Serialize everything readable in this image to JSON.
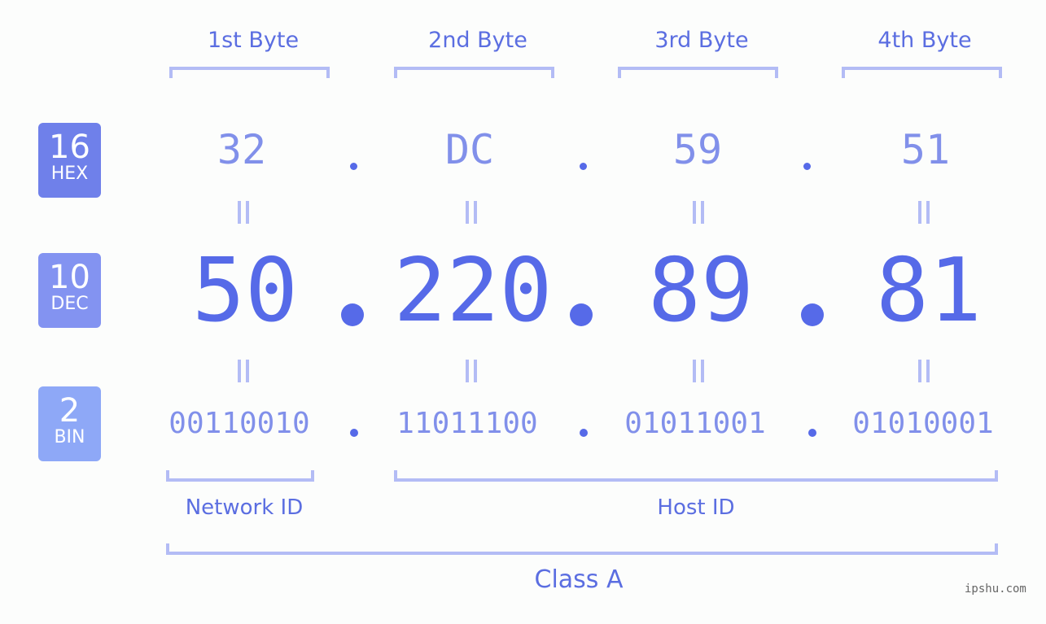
{
  "headers": [
    "1st Byte",
    "2nd Byte",
    "3rd Byte",
    "4th Byte"
  ],
  "badges": {
    "hex": {
      "number": "16",
      "label": "HEX",
      "color": "#6f80ea"
    },
    "dec": {
      "number": "10",
      "label": "DEC",
      "color": "#8393f1"
    },
    "bin": {
      "number": "2",
      "label": "BIN",
      "color": "#8ea8f7"
    }
  },
  "hex_values": [
    "32",
    "DC",
    "59",
    "51"
  ],
  "dec_values": [
    "50",
    "220",
    "89",
    "81"
  ],
  "bin_values": [
    "00110010",
    "11011100",
    "01011001",
    "01010001"
  ],
  "labels": {
    "network_id": "Network ID",
    "host_id": "Host ID",
    "class": "Class A"
  },
  "watermark": "ipshu.com",
  "colors": {
    "accent": "#566ae8",
    "light_accent": "#8190ea",
    "bracket": "#b3bcf5"
  }
}
